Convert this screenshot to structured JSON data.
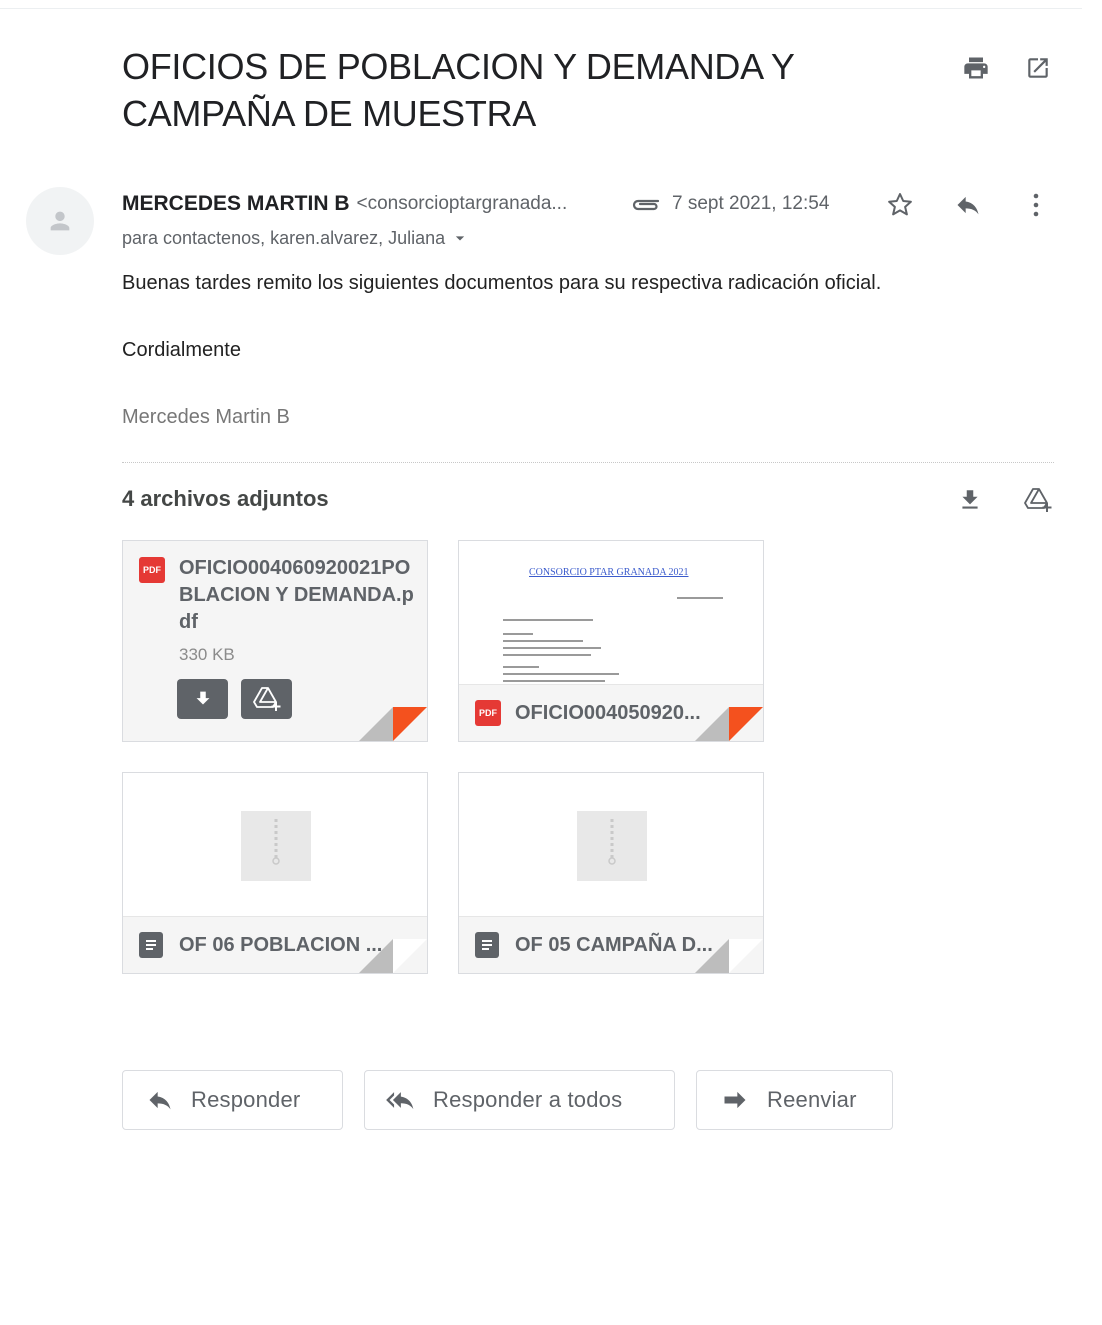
{
  "subject": "OFICIOS DE POBLACION Y DEMANDA Y CAMPAÑA DE MUESTRA",
  "header_icons": [
    "print-icon",
    "open-in-new-window-icon"
  ],
  "message": {
    "sender_name": "MERCEDES MARTIN B",
    "sender_email": "<consorcioptargranada...",
    "date": "7 sept 2021, 12:54",
    "recipients": "para contactenos, karen.alvarez, Juliana",
    "body_lines": [
      "Buenas tardes remito los siguientes documentos para su respectiva radicación oficial.",
      "Cordialmente"
    ],
    "signature": "Mercedes Martin B"
  },
  "attachments": {
    "title": "4 archivos adjuntos",
    "items": [
      {
        "name": "OFICIO004060920021POBLACION Y DEMANDA.pdf",
        "size": "330 KB",
        "type": "pdf"
      },
      {
        "name": "OFICIO004050920...",
        "type": "pdf",
        "preview_heading": "CONSORCIO PTAR GRANADA 2021"
      },
      {
        "name": "OF 06 POBLACION ...",
        "type": "doc"
      },
      {
        "name": "OF 05 CAMPAÑA D...",
        "type": "doc"
      }
    ]
  },
  "actions": {
    "reply": "Responder",
    "reply_all": "Responder a todos",
    "forward": "Reenviar"
  },
  "colors": {
    "pdf_red": "#e53935",
    "fold_red": "#f4511e",
    "icon_grey": "#5f6368"
  }
}
